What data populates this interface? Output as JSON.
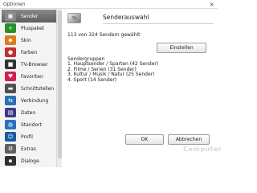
{
  "window": {
    "title": "Optionen",
    "close_glyph": "×"
  },
  "sidebar": {
    "items": [
      {
        "label": "Sender",
        "icon": "tv-icon",
        "color": "#888888",
        "glyph": "▣"
      },
      {
        "label": "Pluspaket",
        "icon": "package-icon",
        "color": "#2a8f2a",
        "glyph": "+"
      },
      {
        "label": "Skin",
        "icon": "skin-icon",
        "color": "#e07a1a",
        "glyph": "◆"
      },
      {
        "label": "Farben",
        "icon": "palette-icon",
        "color": "#c03030",
        "glyph": "●"
      },
      {
        "label": "TV-Browser",
        "icon": "browser-icon",
        "color": "#333333",
        "glyph": "■"
      },
      {
        "label": "Favoriten",
        "icon": "heart-icon",
        "color": "#d02050",
        "glyph": "♥"
      },
      {
        "label": "Schnittstellen",
        "icon": "plug-icon",
        "color": "#505050",
        "glyph": "▬"
      },
      {
        "label": "Verbindung",
        "icon": "connection-icon",
        "color": "#2a6fb8",
        "glyph": "⇆"
      },
      {
        "label": "Daten",
        "icon": "data-icon",
        "color": "#3a3a8a",
        "glyph": "▤"
      },
      {
        "label": "Standort",
        "icon": "globe-icon",
        "color": "#2a70c0",
        "glyph": "◍"
      },
      {
        "label": "Profil",
        "icon": "profile-icon",
        "color": "#1a5aa0",
        "glyph": "☺"
      },
      {
        "label": "Extras",
        "icon": "gear-icon",
        "color": "#606060",
        "glyph": "⚙"
      },
      {
        "label": "Dialoge",
        "icon": "dialog-icon",
        "color": "#303030",
        "glyph": "▪"
      }
    ]
  },
  "main": {
    "logo_text": "TV",
    "heading": "Senderauswahl",
    "count_text": "113 von 324 Sendern gewählt",
    "settings_button": "Einstellen",
    "groups_title": "Sendergruppen",
    "groups": [
      "1. Hauptsender / Sparten  (42 Sender)",
      "2. Filme / Serien  (31 Sender)",
      "3. Kultur / Musik / Natur  (25 Sender)",
      "4. Sport  (14 Sender)"
    ],
    "ok_button": "OK",
    "cancel_button": "Abbrechen",
    "watermark": "Computer"
  }
}
